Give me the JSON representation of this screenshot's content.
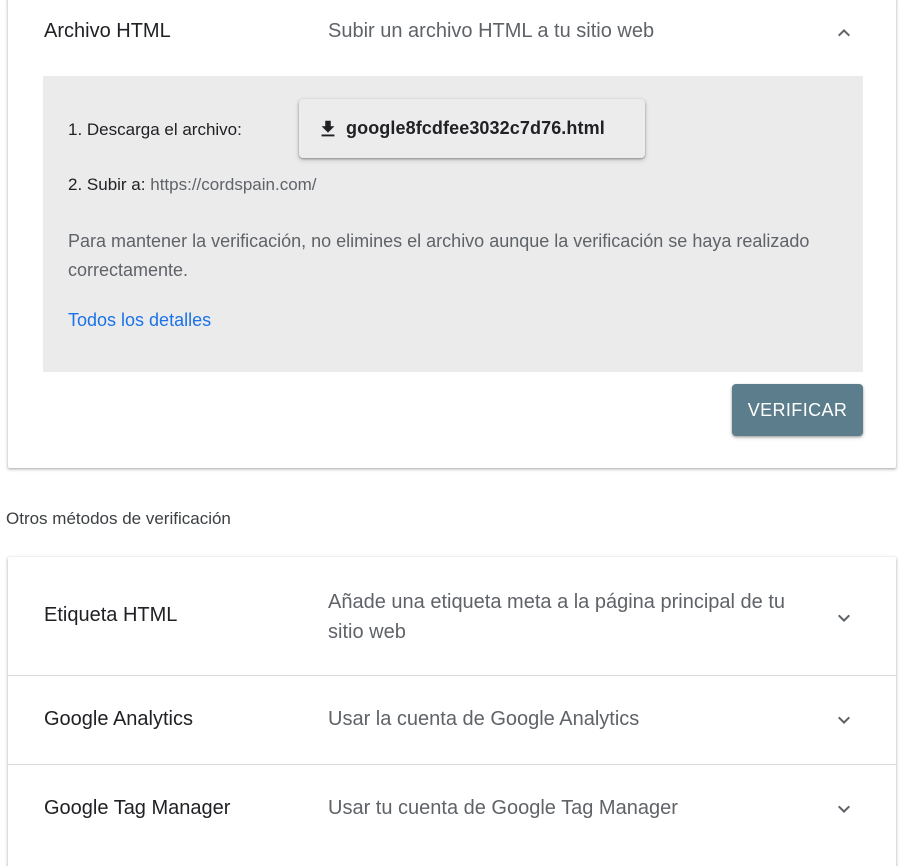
{
  "html_file_method": {
    "title": "Archivo HTML",
    "description": "Subir un archivo HTML a tu sitio web",
    "expanded": true,
    "step1_label": "1. Descarga el archivo:",
    "download_filename": "google8fcdfee3032c7d76.html",
    "step2_label": "2. Subir a:",
    "step2_url": "https://cordspain.com/",
    "note": "Para mantener la verificación, no elimines el archivo aunque la verificación se haya realizado correctamente.",
    "details_link": "Todos los detalles",
    "verify_button": "VERIFICAR"
  },
  "other_methods": {
    "heading": "Otros métodos de verificación",
    "items": [
      {
        "title": "Etiqueta HTML",
        "description": "Añade una etiqueta meta a la página principal de tu sitio web",
        "expanded": false
      },
      {
        "title": "Google Analytics",
        "description": "Usar la cuenta de Google Analytics",
        "expanded": false
      },
      {
        "title": "Google Tag Manager",
        "description": "Usar tu cuenta de Google Tag Manager",
        "expanded": false
      }
    ]
  },
  "colors": {
    "panel_bg": "#ebebeb",
    "verify_button_bg": "#5c7d8b",
    "link": "#1a73e8",
    "secondary_text": "#5f6368"
  },
  "icons": {
    "collapse": "chevron-up-icon",
    "expand": "chevron-down-icon",
    "download": "download-icon"
  }
}
